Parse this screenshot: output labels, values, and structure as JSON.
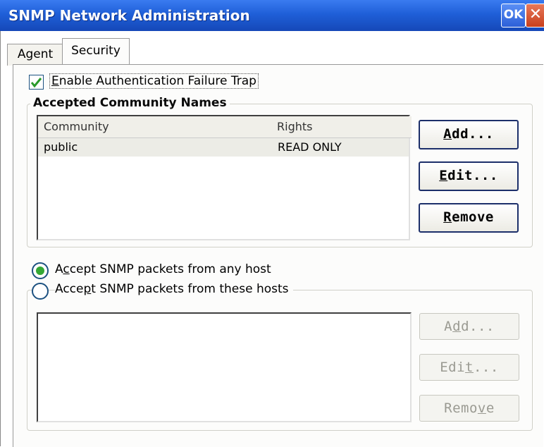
{
  "window": {
    "title": "SNMP Network Administration",
    "ok_label": "OK",
    "close_glyph": "✕"
  },
  "tabs": [
    {
      "label": "Agent"
    },
    {
      "label": "Security"
    }
  ],
  "auth_trap": {
    "label_pre": "E",
    "label_rest": "nable Authentication Failure Trap",
    "checked": true
  },
  "community": {
    "legend": "Accepted Community Names",
    "columns": [
      "Community",
      "Rights"
    ],
    "rows": [
      {
        "community": "public",
        "rights": "READ ONLY"
      }
    ],
    "buttons": {
      "add_pre": "A",
      "add_rest": "dd...",
      "edit_pre": "E",
      "edit_rest": "dit...",
      "remove_pre": "R",
      "remove_rest": "emove"
    }
  },
  "hosts": {
    "any": {
      "pre": "A",
      "ul": "c",
      "post": "cept SNMP packets from any host",
      "selected": true
    },
    "these": {
      "pre": "Acce",
      "ul": "p",
      "post": "t SNMP packets from these hosts",
      "selected": false
    },
    "buttons": {
      "add_pre": "A",
      "add_ul": "d",
      "add_post": "d...",
      "edit_pre": "Edi",
      "edit_ul": "t",
      "edit_post": "...",
      "remove_pre": "Remo",
      "remove_ul": "v",
      "remove_post": "e"
    }
  },
  "colors": {
    "titlebar": "#1f5fd8",
    "check": "#2a9a2a",
    "radio_dot": "#34a834"
  }
}
